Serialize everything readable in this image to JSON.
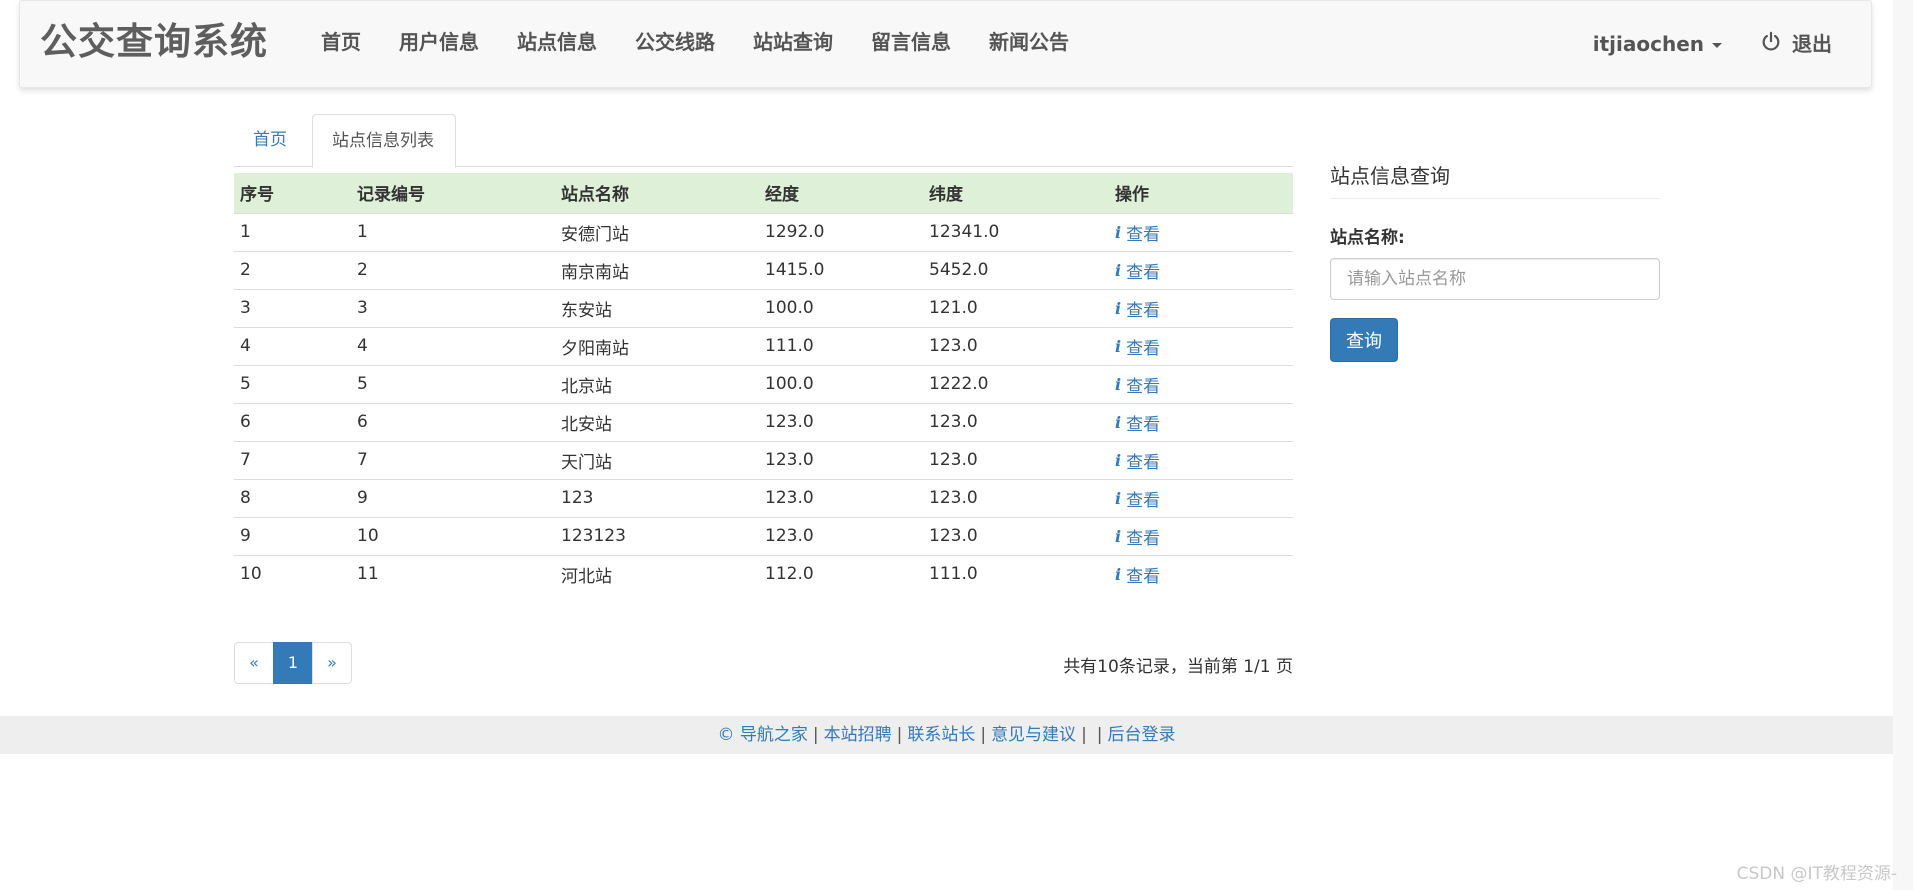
{
  "navbar": {
    "brand": "公交查询系统",
    "items": [
      {
        "label": "首页"
      },
      {
        "label": "用户信息"
      },
      {
        "label": "站点信息"
      },
      {
        "label": "公交线路"
      },
      {
        "label": "站站查询"
      },
      {
        "label": "留言信息"
      },
      {
        "label": "新闻公告"
      }
    ],
    "user": "itjiaochen",
    "logout": "退出"
  },
  "tabs": {
    "home": "首页",
    "list": "站点信息列表"
  },
  "table": {
    "headers": [
      "序号",
      "记录编号",
      "站点名称",
      "经度",
      "纬度",
      "操作"
    ],
    "action_label": "查看",
    "rows": [
      [
        "1",
        "1",
        "安德门站",
        "1292.0",
        "12341.0"
      ],
      [
        "2",
        "2",
        "南京南站",
        "1415.0",
        "5452.0"
      ],
      [
        "3",
        "3",
        "东安站",
        "100.0",
        "121.0"
      ],
      [
        "4",
        "4",
        "夕阳南站",
        "111.0",
        "123.0"
      ],
      [
        "5",
        "5",
        "北京站",
        "100.0",
        "1222.0"
      ],
      [
        "6",
        "6",
        "北安站",
        "123.0",
        "123.0"
      ],
      [
        "7",
        "7",
        "天门站",
        "123.0",
        "123.0"
      ],
      [
        "8",
        "9",
        "123",
        "123.0",
        "123.0"
      ],
      [
        "9",
        "10",
        "123123",
        "123.0",
        "123.0"
      ],
      [
        "10",
        "11",
        "河北站",
        "112.0",
        "111.0"
      ]
    ]
  },
  "pagination": {
    "prev": "«",
    "current": "1",
    "next": "»",
    "summary": "共有10条记录，当前第 1/1 页"
  },
  "sidebar": {
    "title": "站点信息查询",
    "field_label": "站点名称:",
    "placeholder": "请输入站点名称",
    "button": "查询"
  },
  "footer": {
    "links": [
      "© 导航之家",
      "本站招聘",
      "联系站长",
      "意见与建议",
      "",
      "后台登录"
    ]
  },
  "watermark": "CSDN @IT教程资源-",
  "colors": {
    "primary": "#337ab7",
    "header_row": "#dff0d8",
    "navbar_bg": "#f8f8f8",
    "footer_bg": "#eeeeee"
  }
}
